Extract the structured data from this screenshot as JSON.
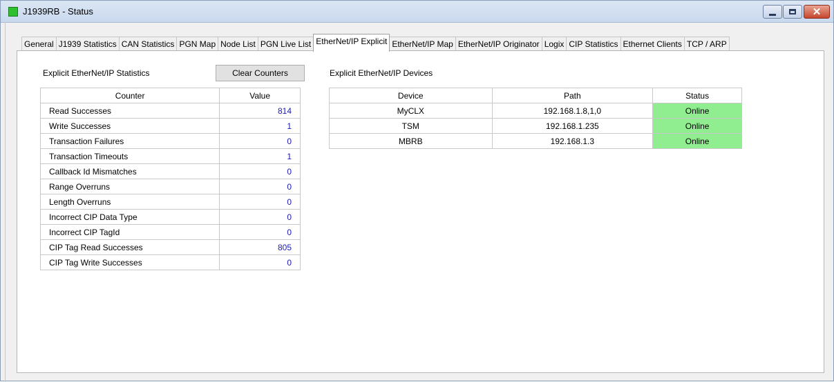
{
  "window": {
    "title": "J1939RB - Status",
    "app_icon_color": "#2fc02f",
    "buttons": {
      "minimize": "minimize",
      "maximize": "maximize",
      "close": "✕"
    }
  },
  "tabs": [
    "General",
    "J1939 Statistics",
    "CAN Statistics",
    "PGN Map",
    "Node List",
    "PGN Live List",
    "EtherNet/IP Explicit",
    "EtherNet/IP Map",
    "EtherNet/IP Originator",
    "Logix",
    "CIP Statistics",
    "Ethernet Clients",
    "TCP / ARP"
  ],
  "active_tab": "EtherNet/IP Explicit",
  "stats": {
    "heading": "Explicit EtherNet/IP Statistics",
    "clear_button": "Clear Counters",
    "columns": [
      "Counter",
      "Value"
    ],
    "rows": [
      {
        "counter": "Read Successes",
        "value": "814"
      },
      {
        "counter": "Write Successes",
        "value": "1"
      },
      {
        "counter": "Transaction Failures",
        "value": "0"
      },
      {
        "counter": "Transaction Timeouts",
        "value": "1"
      },
      {
        "counter": "Callback Id Mismatches",
        "value": "0"
      },
      {
        "counter": "Range Overruns",
        "value": "0"
      },
      {
        "counter": "Length Overruns",
        "value": "0"
      },
      {
        "counter": "Incorrect CIP Data Type",
        "value": "0"
      },
      {
        "counter": "Incorrect CIP TagId",
        "value": "0"
      },
      {
        "counter": "CIP Tag Read Successes",
        "value": "805"
      },
      {
        "counter": "CIP Tag Write Successes",
        "value": "0"
      }
    ]
  },
  "devices": {
    "heading": "Explicit EtherNet/IP Devices",
    "columns": [
      "Device",
      "Path",
      "Status"
    ],
    "rows": [
      {
        "device": "MyCLX",
        "path": "192.168.1.8,1,0",
        "status": "Online"
      },
      {
        "device": "TSM",
        "path": "192.168.1.235",
        "status": "Online"
      },
      {
        "device": "MBRB",
        "path": "192.168.1.3",
        "status": "Online"
      }
    ],
    "online_color": "#90ee90"
  }
}
